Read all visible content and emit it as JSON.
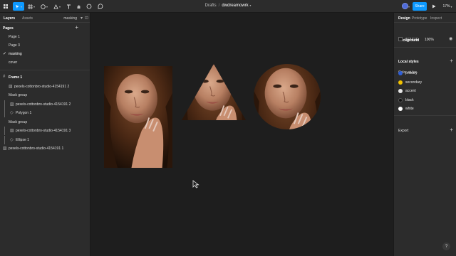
{
  "toolbar": {
    "menu_icon": "figma-menu-icon",
    "breadcrumb_project": "Drafts",
    "breadcrumb_sep": "/",
    "file_name": "dwdreamowrk",
    "share_label": "Share",
    "zoom_label": "17%"
  },
  "left_panel": {
    "tabs": [
      "Layers",
      "Assets"
    ],
    "page_select": "masking",
    "pages_header": "Pages",
    "pages": [
      "Page 1",
      "Page 3",
      "masking",
      "cover"
    ],
    "current_page": "masking",
    "layers": [
      {
        "label": "Frame 1",
        "kind": "frame"
      },
      {
        "label": "pexels-cottonbro-studio-4154191 2",
        "kind": "image"
      },
      {
        "label": "Mask group",
        "kind": "group"
      },
      {
        "label": "pexels-cottonbro-studio-4154191 2",
        "kind": "image"
      },
      {
        "label": "Polygon 1",
        "kind": "shape"
      },
      {
        "label": "Mask group",
        "kind": "group"
      },
      {
        "label": "pexels-cottonbro-studio-4154191 3",
        "kind": "image"
      },
      {
        "label": "Ellipse 1",
        "kind": "shape"
      },
      {
        "label": "pexels-cottonbro-studio-4154191 1",
        "kind": "image"
      }
    ]
  },
  "right_panel": {
    "tabs": [
      "Design",
      "Prototype",
      "Inspect"
    ],
    "background_header": "Background",
    "background_hex": "1E1E1E",
    "background_opacity": "100%",
    "local_styles_header": "Local styles",
    "color_styles_header": "Color styles",
    "color_styles": [
      {
        "name": "primary",
        "color": "#2f5fd8"
      },
      {
        "name": "secondary",
        "color": "#f2c200"
      },
      {
        "name": "accent",
        "color": "#e6e6e6"
      },
      {
        "name": "black",
        "color": "#111111"
      },
      {
        "name": "white",
        "color": "#ffffff"
      }
    ],
    "export_header": "Export"
  },
  "help_label": "?",
  "colors": {
    "accent": "#0d99ff",
    "panel": "#2c2c2c",
    "canvas": "#1e1e1e"
  }
}
